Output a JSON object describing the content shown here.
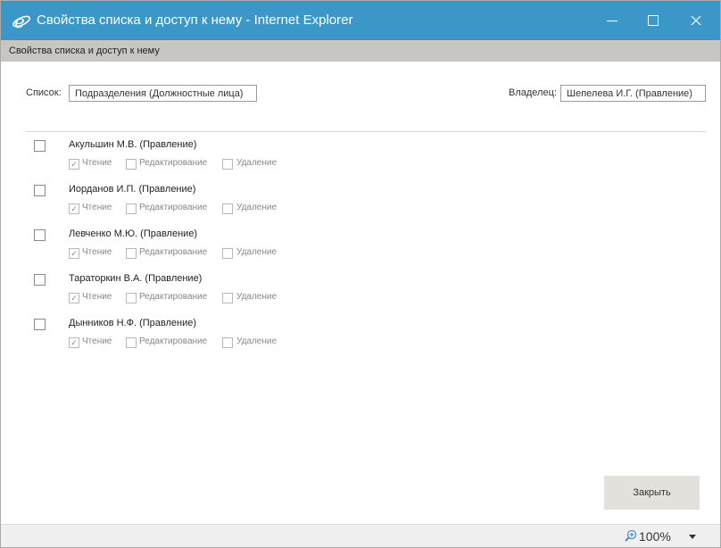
{
  "window": {
    "title": "Свойства списка и доступ к нему - Internet Explorer",
    "icon": "internet-explorer-icon"
  },
  "subheader": "Свойства списка и доступ к нему",
  "list": {
    "label": "Список:",
    "value": "Подразделения (Должностные лица)"
  },
  "owner": {
    "label": "Владелец:",
    "value": "Шепелева И.Г. (Правление)"
  },
  "permissions": {
    "read": "Чтение",
    "edit": "Редактирование",
    "delete": "Удаление"
  },
  "users": [
    {
      "name": "Акульшин М.В. (Правление)",
      "selected": false,
      "read": true,
      "edit": false,
      "delete": false
    },
    {
      "name": "Иорданов И.П. (Правление)",
      "selected": false,
      "read": true,
      "edit": false,
      "delete": false
    },
    {
      "name": "Левченко М.Ю. (Правление)",
      "selected": false,
      "read": true,
      "edit": false,
      "delete": false
    },
    {
      "name": "Тараторкин В.А. (Правление)",
      "selected": false,
      "read": true,
      "edit": false,
      "delete": false
    },
    {
      "name": "Дынников Н.Ф. (Правление)",
      "selected": false,
      "read": true,
      "edit": false,
      "delete": false
    }
  ],
  "close_button": "Закрыть",
  "status": {
    "zoom": "100%"
  },
  "colors": {
    "titlebar": "#3a97c8",
    "subheader": "#c7c6c2",
    "button": "#e3e1dc",
    "statusbar": "#f0f0f0"
  }
}
